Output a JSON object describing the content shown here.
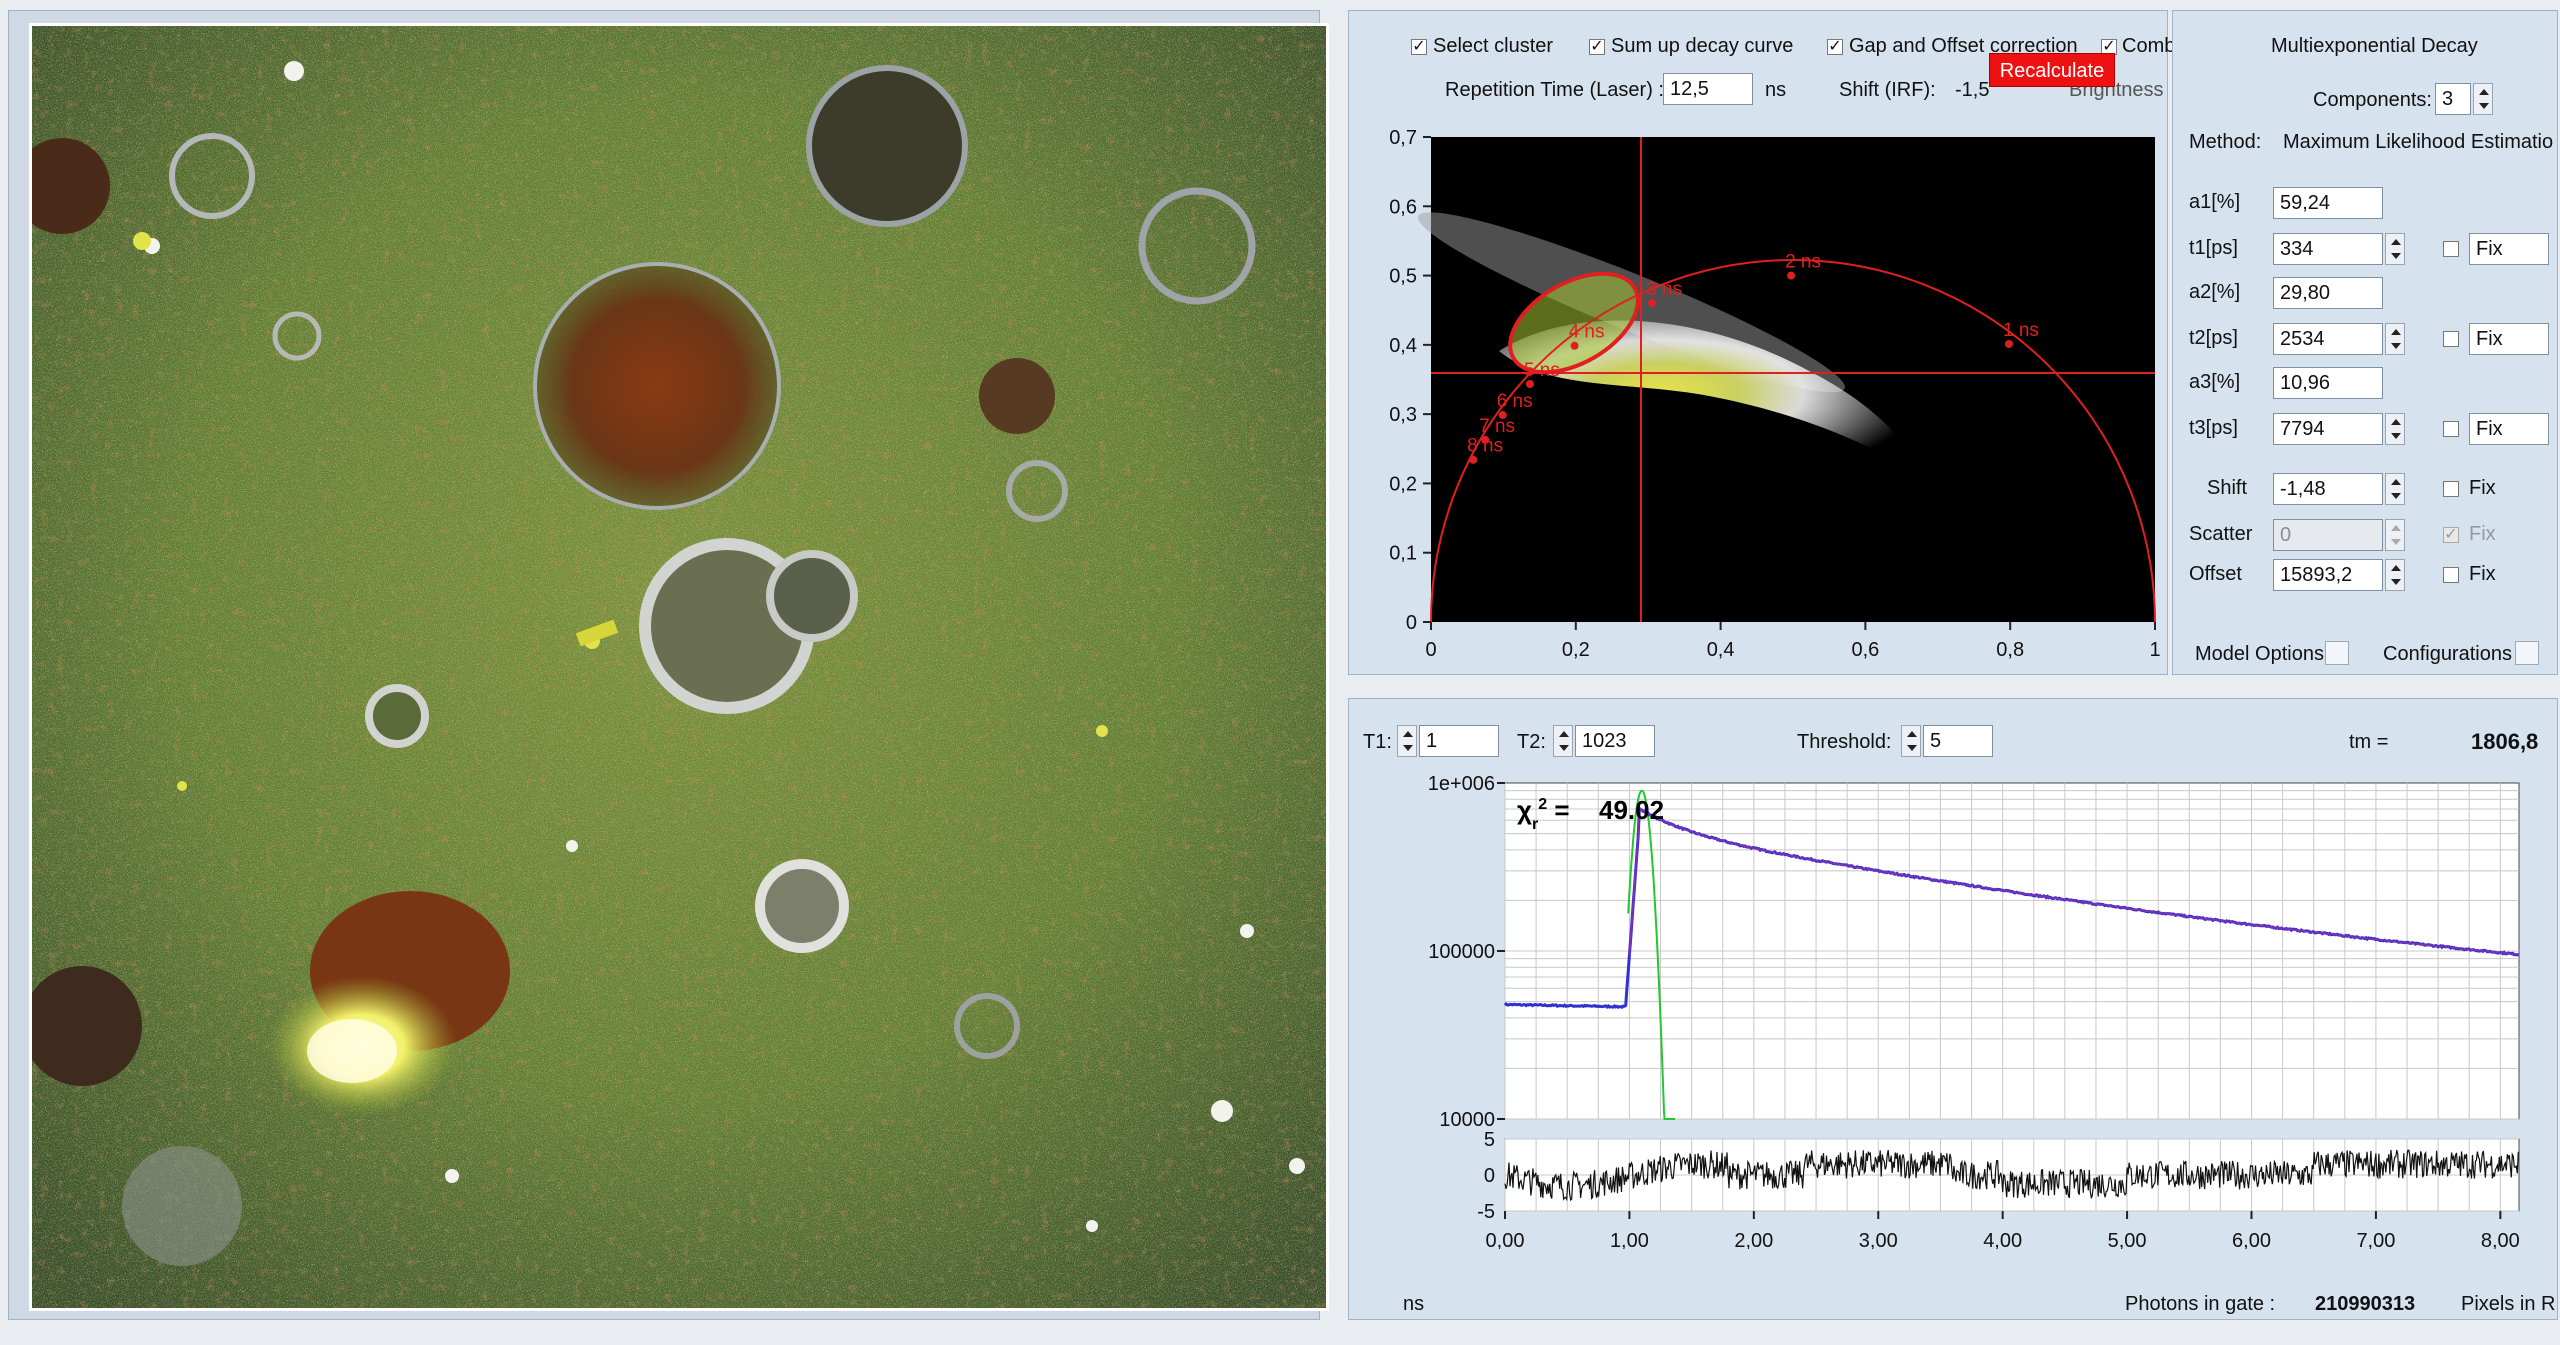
{
  "image_panel": {
    "alt": "fluorescence lifetime microscopy image"
  },
  "top_options": {
    "select_cluster": "Select cluster",
    "sum_up_decay": "Sum up decay curve",
    "gap_offset": "Gap and Offset correction",
    "comb": "Comb",
    "repetition_label": "Repetition Time (Laser) :",
    "repetition_value": "12,5",
    "repetition_unit": "ns",
    "shift_label": "Shift  (IRF):",
    "shift_value": "-1,5",
    "recalculate": "Recalculate",
    "brightness": "Brightness"
  },
  "phasor": {
    "y_ticks": [
      "0,7",
      "0,6",
      "0,5",
      "0,4",
      "0,3",
      "0,2",
      "0,1",
      "0"
    ],
    "x_ticks": [
      "0",
      "0,2",
      "0,4",
      "0,6",
      "0,8",
      "1"
    ],
    "semicircle_labels": [
      "1 ns",
      "2 ns",
      "3 ns",
      "4 ns",
      "5 ns",
      "6 ns",
      "7 ns",
      "8 ns"
    ],
    "cursor_g": 0.29,
    "cursor_s": 0.36
  },
  "fit": {
    "title": "Multiexponential Decay",
    "components_label": "Components:",
    "components_value": "3",
    "method_label": "Method:",
    "method_value": "Maximum Likelihood Estimation",
    "rows": [
      {
        "label": "a1[%]",
        "value": "59,24"
      },
      {
        "label": "t1[ps]",
        "value": "334",
        "fix": "Fix"
      },
      {
        "label": "a2[%]",
        "value": "29,80"
      },
      {
        "label": "t2[ps]",
        "value": "2534",
        "fix": "Fix"
      },
      {
        "label": "a3[%]",
        "value": "10,96"
      },
      {
        "label": "t3[ps]",
        "value": "7794",
        "fix": "Fix"
      }
    ],
    "shift_label": "Shift",
    "shift_value": "-1,48",
    "scatter_label": "Scatter",
    "scatter_value": "0",
    "offset_label": "Offset",
    "offset_value": "15893,2",
    "fix": "Fix",
    "model_options": "Model Options",
    "configurations": "Configurations"
  },
  "decay": {
    "t1_label": "T1:",
    "t1_value": "1",
    "t2_label": "T2:",
    "t2_value": "1023",
    "threshold_label": "Threshold:",
    "threshold_value": "5",
    "tm_label": "tm =",
    "tm_value": "1806,8",
    "chi_value": "49.02",
    "y_ticks": [
      "1e+006",
      "100000",
      "10000"
    ],
    "res_ticks": [
      "5",
      "0",
      "-5"
    ],
    "x_ticks": [
      "0,00",
      "1,00",
      "2,00",
      "3,00",
      "4,00",
      "5,00",
      "6,00",
      "7,00",
      "8,00"
    ],
    "x_unit": "ns",
    "photons_label": "Photons in gate :",
    "photons_value": "210990313",
    "pixels_label": "Pixels in R"
  },
  "colors": {
    "panel": "#d7e2ef",
    "fit_line": "#7a2fb8",
    "data": "#3030d0",
    "irf": "#22c830",
    "phasor_red": "#e02020",
    "recalc": "#ee1111"
  }
}
